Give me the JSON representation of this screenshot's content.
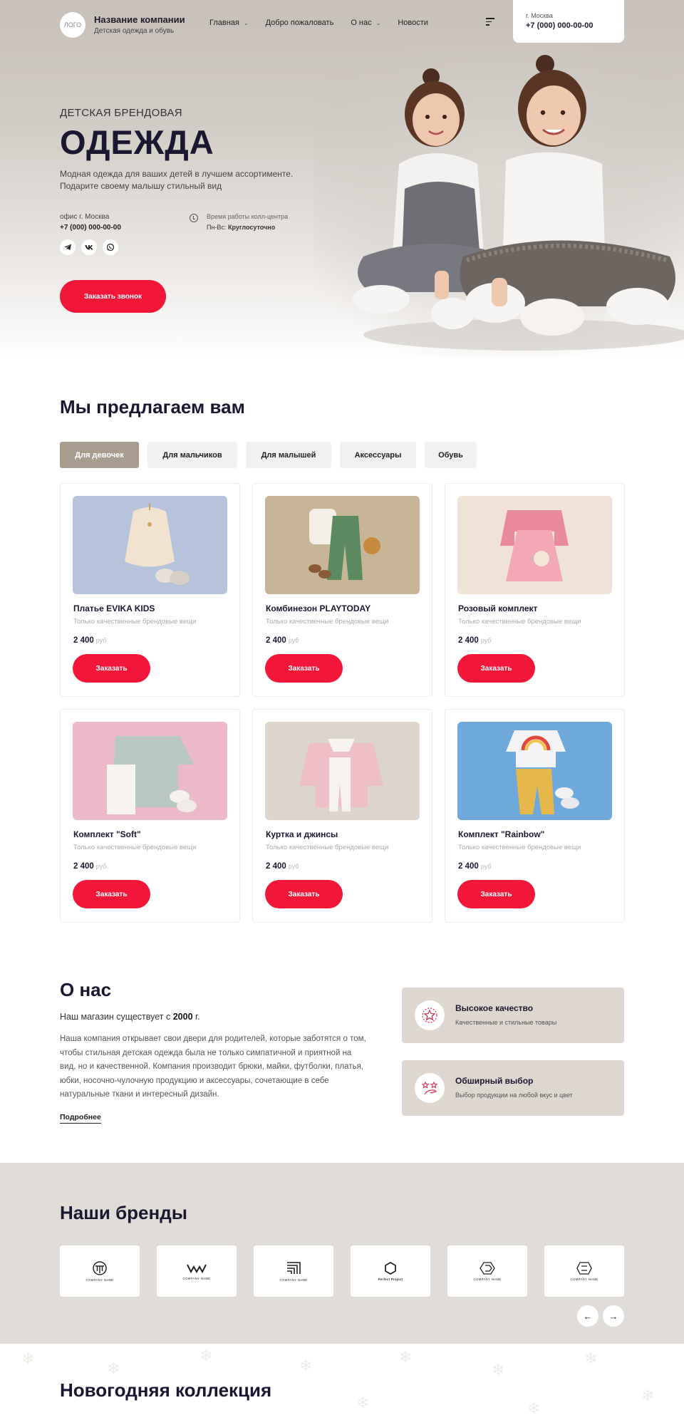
{
  "header": {
    "logo_text": "ЛОГО",
    "company_name": "Название компании",
    "company_sub": "Детская одежда и обувь",
    "nav": [
      {
        "label": "Главная",
        "has_dropdown": true
      },
      {
        "label": "Добро пожаловать",
        "has_dropdown": false
      },
      {
        "label": "О нас",
        "has_dropdown": true
      },
      {
        "label": "Новости",
        "has_dropdown": false
      }
    ],
    "city": "г. Москва",
    "phone": "+7 (000) 000-00-00"
  },
  "hero": {
    "kicker": "ДЕТСКАЯ БРЕНДОВАЯ",
    "title": "ОДЕЖДА",
    "text": "Модная одежда для ваших детей в лучшем ассортименте. Подарите своему малышу стильный вид",
    "office_label": "офис г. Москва",
    "office_phone": "+7 (000) 000-00-00",
    "hours_label": "Время работы колл-центра",
    "hours_days": "Пн-Вс:",
    "hours_value": "Круглосуточно",
    "socials": [
      "telegram-icon",
      "vk-icon",
      "whatsapp-icon"
    ],
    "call_button": "Заказать звонок"
  },
  "offers": {
    "title": "Мы предлагаем вам",
    "tabs": [
      "Для девочек",
      "Для мальчиков",
      "Для малышей",
      "Аксессуары",
      "Обувь"
    ],
    "active_tab": 0,
    "products": [
      {
        "name": "Платье EVIKA KIDS",
        "desc": "Только качественные брендовые вещи",
        "price": "2 400",
        "currency": "руб",
        "button": "Заказать",
        "bg": "#b7c2dc"
      },
      {
        "name": "Комбинезон PLAYTODAY",
        "desc": "Только качественные брендовые вещи",
        "price": "2 400",
        "currency": "руб",
        "button": "Заказать",
        "bg": "#c7b596"
      },
      {
        "name": "Розовый комплект",
        "desc": "Только качественные брендовые вещи",
        "price": "2 400",
        "currency": "руб",
        "button": "Заказать",
        "bg": "#efe3d5"
      },
      {
        "name": "Комплект \"Soft\"",
        "desc": "Только качественные брендовые вещи",
        "price": "2 400",
        "currency": "руб",
        "button": "Заказать",
        "bg": "#ecb9c8"
      },
      {
        "name": "Куртка и джинсы",
        "desc": "Только качественные брендовые вещи",
        "price": "2 400",
        "currency": "руб",
        "button": "Заказать",
        "bg": "#ddd4cb"
      },
      {
        "name": "Комплект \"Rainbow\"",
        "desc": "Только качественные брендовые вещи",
        "price": "2 400",
        "currency": "руб",
        "button": "Заказать",
        "bg": "#6fa9dc"
      }
    ]
  },
  "about": {
    "title": "О нас",
    "years_prefix": "Наш магазин существует с",
    "years_value": "2000",
    "years_suffix": "г.",
    "text": "Наша компания открывает свои двери для родителей, которые заботятся о том, чтобы стильная детская одежда была не только симпатичной и приятной на вид, но и качественной. Компания производит брюки, майки, футболки, платья, юбки, носочно-чулочную продукцию и аксессуары, сочетающие в себе натуральные ткани и интересный дизайн.",
    "more": "Подробнее",
    "features": [
      {
        "title": "Высокое качество",
        "desc": "Качественные и стильные товары",
        "icon": "star-badge-icon"
      },
      {
        "title": "Обширный выбор",
        "desc": "Выбор продукции на любой вкус и цвет",
        "icon": "stars-hand-icon"
      }
    ]
  },
  "brands": {
    "title": "Наши бренды",
    "items": [
      "COMPANY NAME",
      "COMPANY NAME",
      "COMPANY NAME",
      "Perfect Project",
      "COMPANY NAME",
      "COMPANY NAME"
    ],
    "prev": "←",
    "next": "→"
  },
  "newyear": {
    "title": "Новогодняя коллекция"
  },
  "colors": {
    "accent_red": "#f21739",
    "active_tab": "#a89c8f",
    "beige_panel": "#ddd7d0",
    "heading": "#1a1730"
  }
}
